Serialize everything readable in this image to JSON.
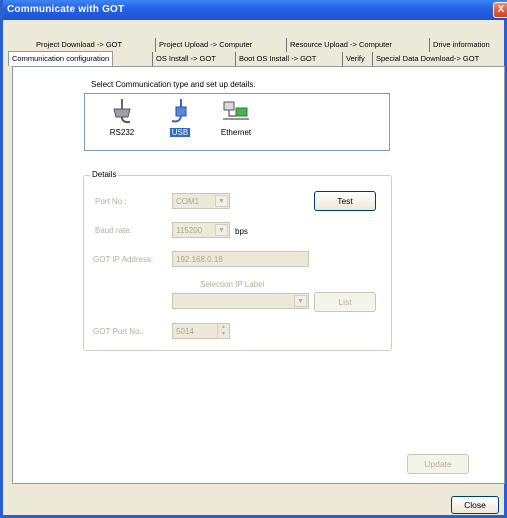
{
  "window": {
    "title": "Communicate with GOT",
    "close_glyph": "X"
  },
  "tabs": {
    "row1": [
      "Project Download -> GOT",
      "Project Upload -> Computer",
      "Resource Upload -> Computer",
      "Drive information"
    ],
    "row2": [
      "Communication configuration",
      "OS Install -> GOT",
      "Boot OS Install -> GOT",
      "Verify",
      "Special Data Download-> GOT"
    ],
    "active": "Communication configuration"
  },
  "comm": {
    "prompt": "Select Communication type and set up details.",
    "items": [
      {
        "label": "RS232",
        "icon": "serial-cable-icon",
        "selected": false
      },
      {
        "label": "USB",
        "icon": "usb-cable-icon",
        "selected": true
      },
      {
        "label": "Ethernet",
        "icon": "ethernet-network-icon",
        "selected": false
      }
    ]
  },
  "details": {
    "legend": "Details",
    "port_label": "Port No.:",
    "port_value": "COM1",
    "test_button": "Test",
    "baud_label": "Baud rate:",
    "baud_value": "115200",
    "baud_unit": "bps",
    "ip_label": "GOT IP Address:",
    "ip_value": "192.168.0.18",
    "select_ip_label": "Selection IP Label",
    "select_ip_value": "",
    "list_button": "List",
    "got_port_label": "GOT Port No.:",
    "got_port_value": "5014"
  },
  "footer": {
    "update_button": "Update",
    "close_button": "Close"
  },
  "colors": {
    "titlebar": "#2563e4",
    "selection": "#316ac5",
    "dialog": "#ece9d8"
  }
}
